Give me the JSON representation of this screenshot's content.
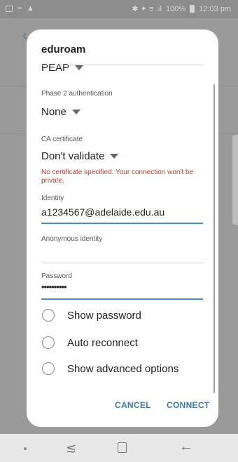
{
  "status_bar": {
    "battery": "100%",
    "time": "12:03 pm",
    "signal_text": "✱ ✦ ≡ .ıl"
  },
  "dialog": {
    "title": "eduroam",
    "eap_method": "PEAP",
    "phase2": {
      "label": "Phase 2 authentication",
      "value": "None"
    },
    "ca_certificate": {
      "label": "CA certificate",
      "value": "Don't validate",
      "warning": "No certificate specified. Your connection won't be private."
    },
    "identity": {
      "label": "Identity",
      "value": "a1234567@adelaide.edu.au"
    },
    "anonymous_identity": {
      "label": "Anonymous identity",
      "value": ""
    },
    "password": {
      "label": "Password",
      "value": "••••••••••"
    },
    "options": [
      {
        "label": "Show password"
      },
      {
        "label": "Auto reconnect"
      },
      {
        "label": "Show advanced options"
      }
    ],
    "cancel_label": "CANCEL",
    "connect_label": "CONNECT"
  },
  "nav_bar": {
    "recent_glyph": "≲",
    "back_glyph": "←"
  },
  "colors": {
    "accent": "#3b78a8",
    "warning": "#c0392b",
    "focus_underline": "#4a90c2"
  }
}
